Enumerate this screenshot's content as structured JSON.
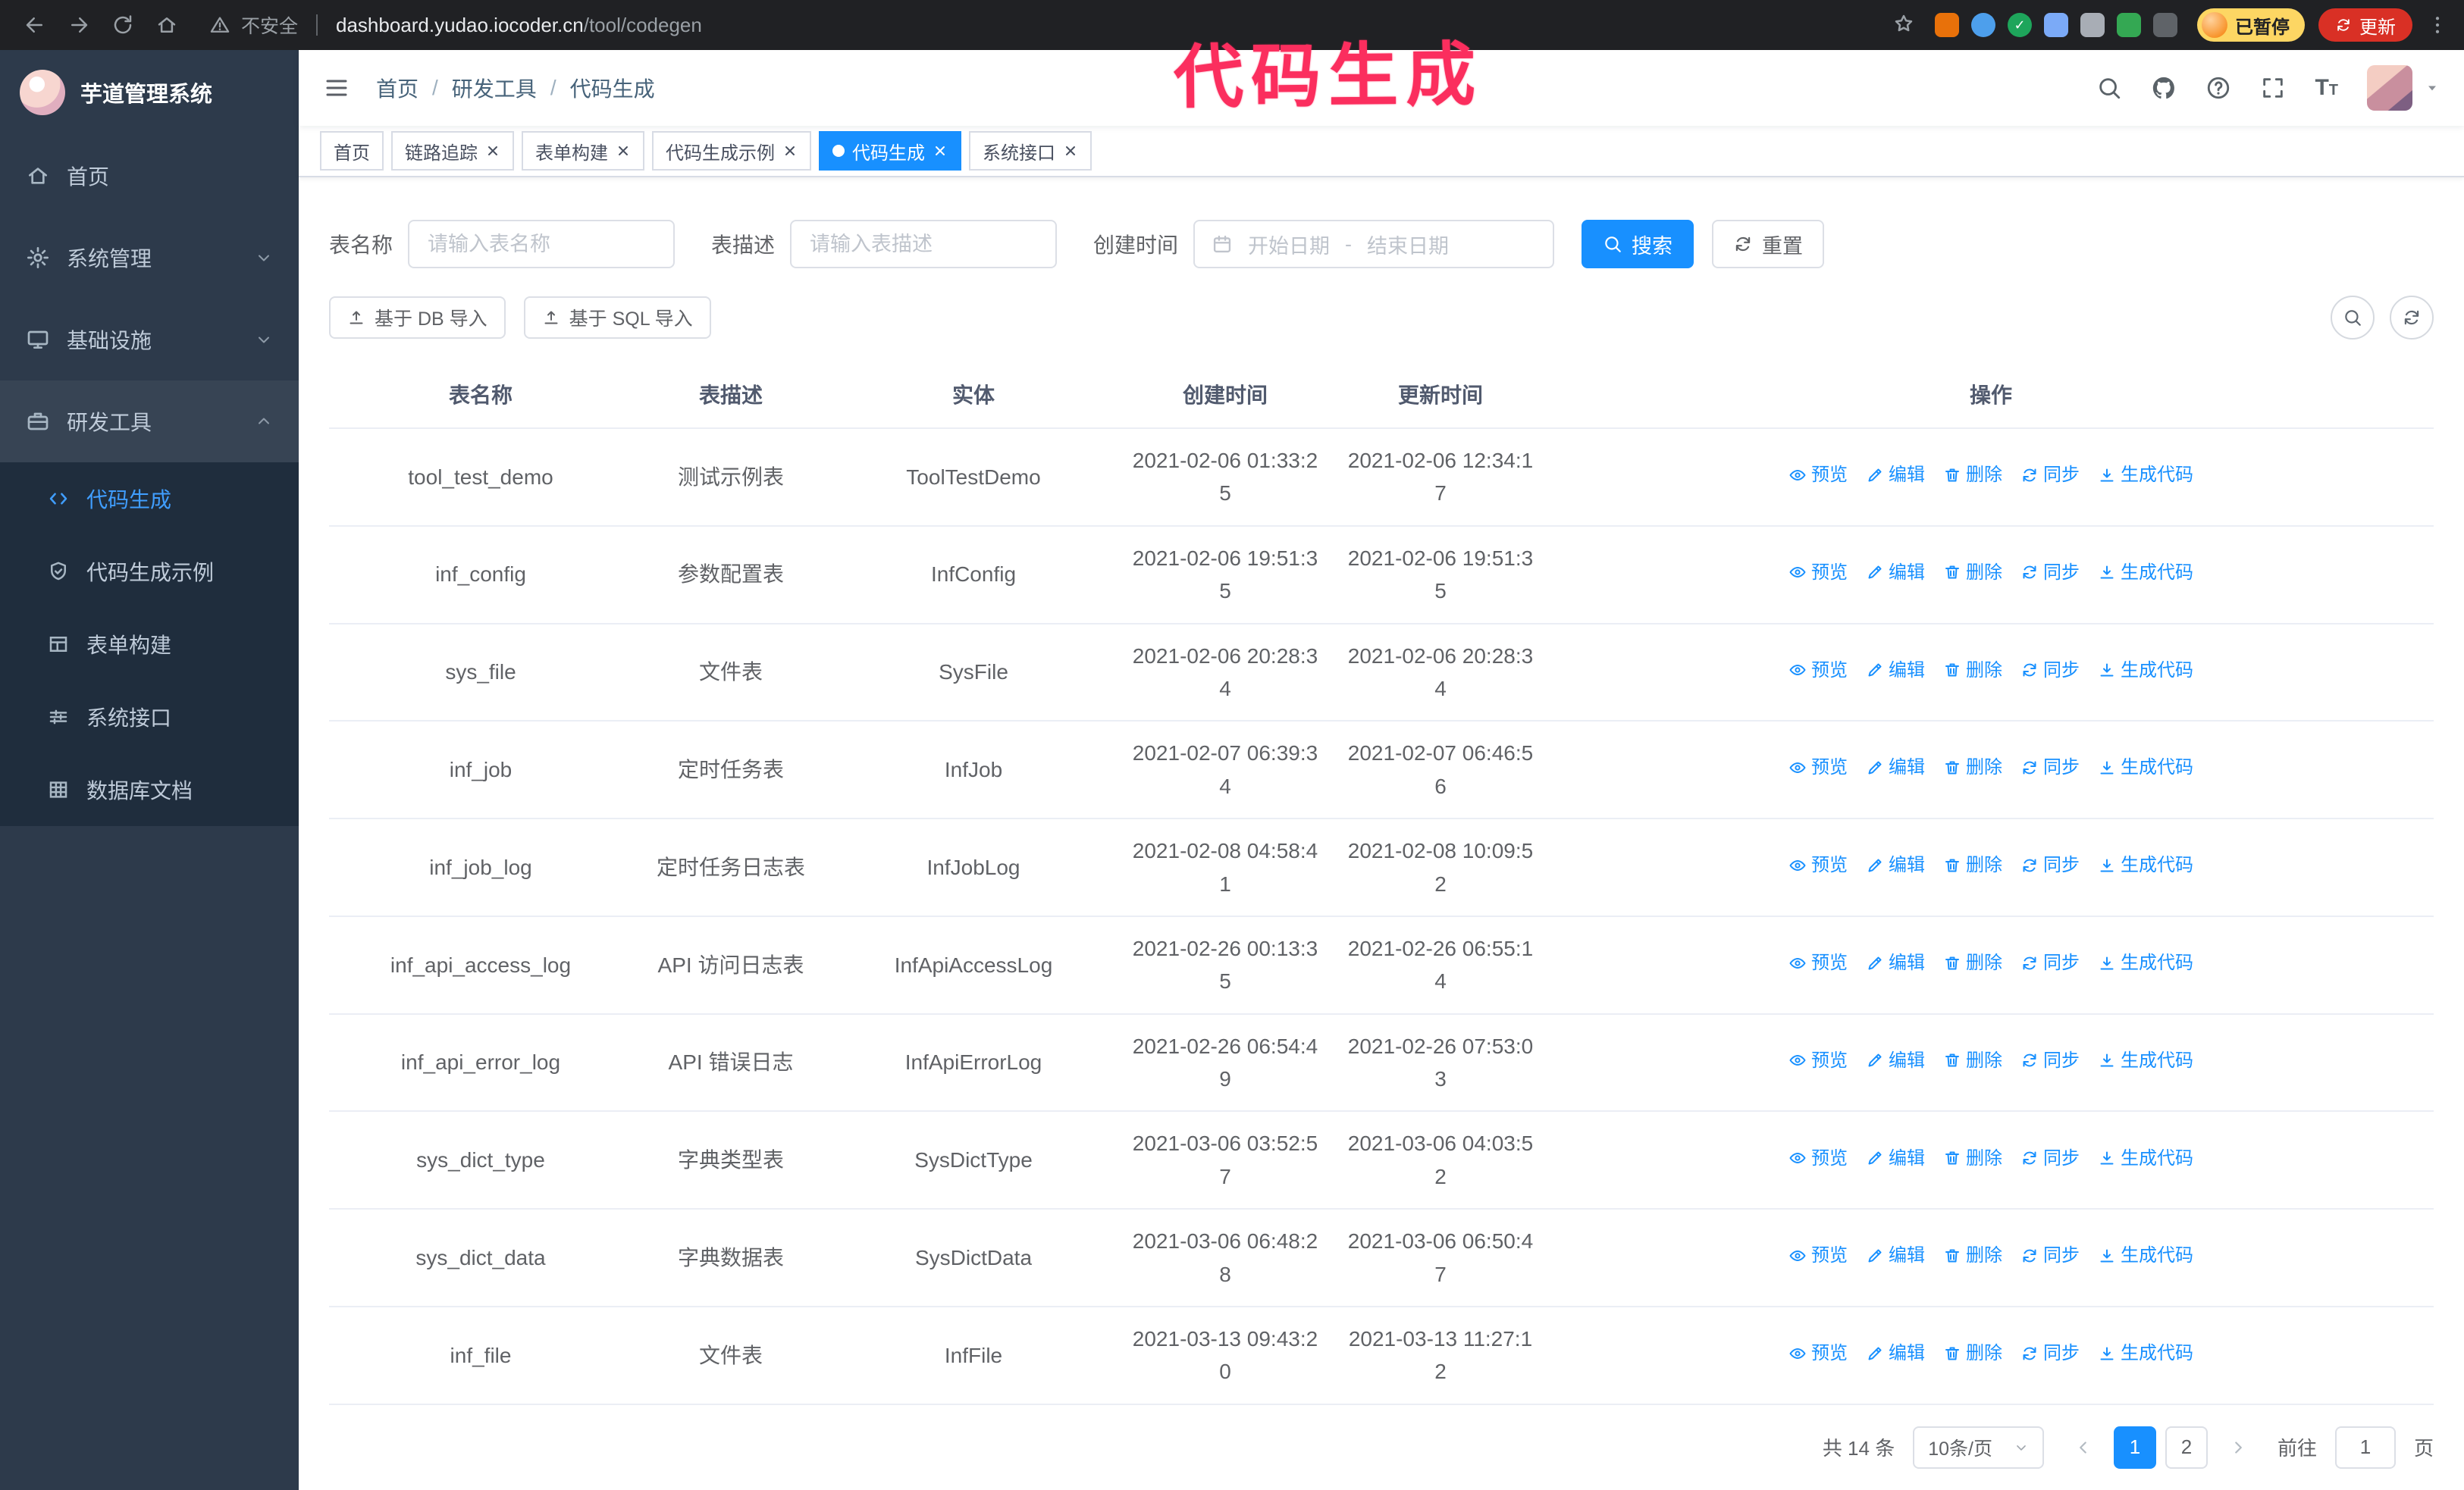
{
  "colors": {
    "accent": "#1890ff",
    "menu_active": "#409eff",
    "chrome_bg": "#202124",
    "sidebar_bg": "#2d3a4b",
    "submenu_bg": "#1f2d3d",
    "annotation": "#fb2e5e",
    "update": "#d93025",
    "paused": "#fdd663"
  },
  "annotation": {
    "text": "代码生成"
  },
  "browser": {
    "security_label": "不安全",
    "url_host": "dashboard.yudao.iocoder.cn",
    "url_path": "/tool/codegen",
    "paused_badge": "已暂停",
    "update_button": "更新",
    "extensions": [
      {
        "name": "orange-extension",
        "color": "#e8710a",
        "shape": "square",
        "glyph": ""
      },
      {
        "name": "blue-extension",
        "color": "#4d9fec",
        "shape": "circle",
        "glyph": ""
      },
      {
        "name": "green-check-extension",
        "color": "#1ea55b",
        "shape": "circle",
        "glyph": "✓"
      },
      {
        "name": "people-extension",
        "color": "#7baaf7",
        "shape": "square",
        "glyph": ""
      },
      {
        "name": "gray-extension",
        "color": "#a8adb5",
        "shape": "square",
        "glyph": ""
      },
      {
        "name": "leaf-extension",
        "color": "#34a853",
        "shape": "square",
        "glyph": ""
      },
      {
        "name": "puzzle-extension",
        "color": "#5f6368",
        "shape": "square",
        "glyph": ""
      }
    ]
  },
  "sidebar": {
    "logo_title": "芋道管理系统",
    "items": [
      {
        "key": "home",
        "icon": "home",
        "label": "首页",
        "expandable": false,
        "expanded": false
      },
      {
        "key": "system",
        "icon": "gear",
        "label": "系统管理",
        "expandable": true,
        "expanded": false
      },
      {
        "key": "infra",
        "icon": "monitor",
        "label": "基础设施",
        "expandable": true,
        "expanded": false
      },
      {
        "key": "dev-tools",
        "icon": "briefcase",
        "label": "研发工具",
        "expandable": true,
        "expanded": true
      }
    ],
    "submenu": [
      {
        "key": "codegen",
        "icon": "code",
        "label": "代码生成",
        "active": true
      },
      {
        "key": "codegen-example",
        "icon": "shield",
        "label": "代码生成示例",
        "active": false
      },
      {
        "key": "form-builder",
        "icon": "grid",
        "label": "表单构建",
        "active": false
      },
      {
        "key": "api",
        "icon": "sliders",
        "label": "系统接口",
        "active": false
      },
      {
        "key": "db-doc",
        "icon": "dbtable",
        "label": "数据库文档",
        "active": false
      }
    ]
  },
  "header": {
    "breadcrumb": [
      "首页",
      "研发工具",
      "代码生成"
    ]
  },
  "tabs": [
    {
      "key": "home",
      "label": "首页",
      "closable": false,
      "active": false
    },
    {
      "key": "tracer",
      "label": "链路追踪",
      "closable": true,
      "active": false
    },
    {
      "key": "form-builder",
      "label": "表单构建",
      "closable": true,
      "active": false
    },
    {
      "key": "codegen-example",
      "label": "代码生成示例",
      "closable": true,
      "active": false
    },
    {
      "key": "codegen",
      "label": "代码生成",
      "closable": true,
      "active": true
    },
    {
      "key": "api",
      "label": "系统接口",
      "closable": true,
      "active": false
    }
  ],
  "filters": {
    "table_name_label": "表名称",
    "table_name_placeholder": "请输入表名称",
    "table_desc_label": "表描述",
    "table_desc_placeholder": "请输入表描述",
    "create_time_label": "创建时间",
    "date_start_placeholder": "开始日期",
    "date_separator": "-",
    "date_end_placeholder": "结束日期",
    "search_button": "搜索",
    "reset_button": "重置"
  },
  "toolbar": {
    "import_db_button": "基于 DB 导入",
    "import_sql_button": "基于 SQL 导入"
  },
  "table": {
    "columns": [
      "表名称",
      "表描述",
      "实体",
      "创建时间",
      "更新时间",
      "操作"
    ],
    "actions": [
      {
        "key": "preview",
        "icon": "eye",
        "label": "预览"
      },
      {
        "key": "edit",
        "icon": "edit",
        "label": "编辑"
      },
      {
        "key": "delete",
        "icon": "trash",
        "label": "删除"
      },
      {
        "key": "sync",
        "icon": "sync",
        "label": "同步"
      },
      {
        "key": "generate-code",
        "icon": "download",
        "label": "生成代码"
      }
    ],
    "rows": [
      {
        "name": "tool_test_demo",
        "desc": "测试示例表",
        "entity": "ToolTestDemo",
        "created": "2021-02-06 01:33:25",
        "updated": "2021-02-06 12:34:17"
      },
      {
        "name": "inf_config",
        "desc": "参数配置表",
        "entity": "InfConfig",
        "created": "2021-02-06 19:51:35",
        "updated": "2021-02-06 19:51:35"
      },
      {
        "name": "sys_file",
        "desc": "文件表",
        "entity": "SysFile",
        "created": "2021-02-06 20:28:34",
        "updated": "2021-02-06 20:28:34"
      },
      {
        "name": "inf_job",
        "desc": "定时任务表",
        "entity": "InfJob",
        "created": "2021-02-07 06:39:34",
        "updated": "2021-02-07 06:46:56"
      },
      {
        "name": "inf_job_log",
        "desc": "定时任务日志表",
        "entity": "InfJobLog",
        "created": "2021-02-08 04:58:41",
        "updated": "2021-02-08 10:09:52"
      },
      {
        "name": "inf_api_access_log",
        "desc": "API 访问日志表",
        "entity": "InfApiAccessLog",
        "created": "2021-02-26 00:13:35",
        "updated": "2021-02-26 06:55:14"
      },
      {
        "name": "inf_api_error_log",
        "desc": "API 错误日志",
        "entity": "InfApiErrorLog",
        "created": "2021-02-26 06:54:49",
        "updated": "2021-02-26 07:53:03"
      },
      {
        "name": "sys_dict_type",
        "desc": "字典类型表",
        "entity": "SysDictType",
        "created": "2021-03-06 03:52:57",
        "updated": "2021-03-06 04:03:52"
      },
      {
        "name": "sys_dict_data",
        "desc": "字典数据表",
        "entity": "SysDictData",
        "created": "2021-03-06 06:48:28",
        "updated": "2021-03-06 06:50:47"
      },
      {
        "name": "inf_file",
        "desc": "文件表",
        "entity": "InfFile",
        "created": "2021-03-13 09:43:20",
        "updated": "2021-03-13 11:27:12"
      }
    ]
  },
  "pagination": {
    "total_text": "共 14 条",
    "page_size": "10条/页",
    "pages": [
      "1",
      "2"
    ],
    "current_page": "1",
    "goto_prefix": "前往",
    "goto_value": "1",
    "goto_suffix": "页"
  }
}
